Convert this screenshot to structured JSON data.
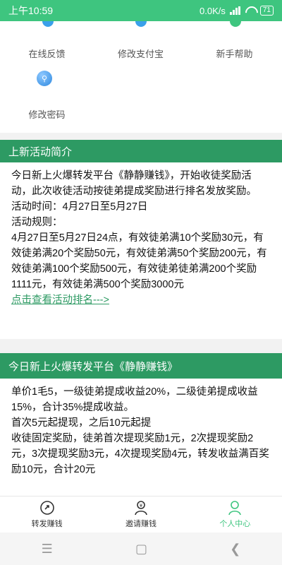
{
  "status_bar": {
    "time": "上午10:59",
    "network_speed": "0.0K/s",
    "battery_level": "71"
  },
  "menu": {
    "row1": [
      {
        "label": "在线反馈",
        "icon": "feedback-icon"
      },
      {
        "label": "修改支付宝",
        "icon": "edit-alipay-icon"
      },
      {
        "label": "新手帮助",
        "icon": "help-icon"
      }
    ],
    "row2": [
      {
        "label": "修改密码",
        "icon": "key-icon"
      }
    ]
  },
  "activity_section": {
    "title": "上新活动简介",
    "intro": "今日新上火爆转发平台《静静赚钱》，开始收徒奖励活动，此次收徒活动按徒弟提成奖励进行排名发放奖励。",
    "time": "活动时间：4月27日至5月27日",
    "rules_label": "活动规则：",
    "rules": "4月27日至5月27日24点，有效徒弟满10个奖励30元，有效徒弟满20个奖励50元，有效徒弟满50个奖励200元，有效徒弟满100个奖励500元，有效徒弟徒弟满200个奖励1111元，有效徒弟满500个奖励3000元",
    "link": "点击查看活动排名--->"
  },
  "platform_section": {
    "title": "今日新上火爆转发平台《静静赚钱》",
    "line1": "单价1毛5，一级徒弟提成收益20%，二级徒弟提成收益15%，合计35%提成收益。",
    "line2": "首次5元起提现，之后10元起提",
    "line3": "收徒固定奖励，徒弟首次提现奖励1元，2次提现奖励2元，3次提现奖励3元，4次提现奖励4元，转发收益满百奖励10元，合计20元"
  },
  "tab_bar": {
    "tabs": [
      {
        "label": "转发赚钱",
        "icon": "share-earn-icon",
        "active": false
      },
      {
        "label": "邀请赚钱",
        "icon": "invite-earn-icon",
        "active": false
      },
      {
        "label": "个人中心",
        "icon": "profile-icon",
        "active": true
      }
    ]
  },
  "nav_bar": {
    "buttons": [
      "menu-icon",
      "home-icon",
      "back-icon"
    ]
  },
  "colors": {
    "status_bar": "#3ec57f",
    "section_header": "#2d9a63",
    "accent": "#3ec57f"
  }
}
